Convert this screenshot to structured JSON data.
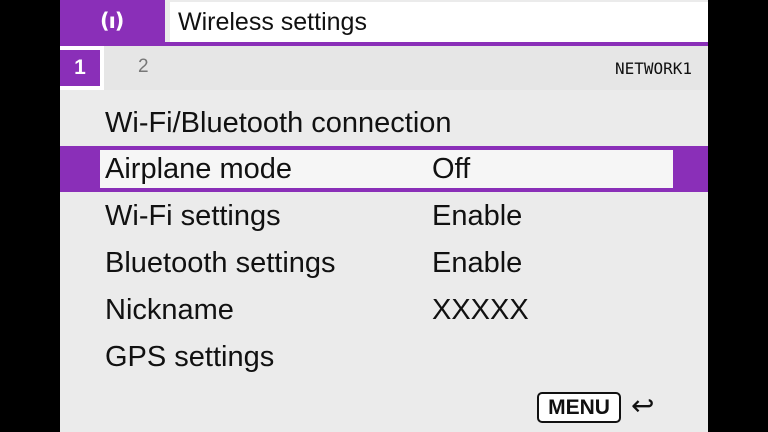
{
  "header": {
    "icon": "wifi-antenna-icon",
    "icon_glyph": "(ı)",
    "title": "Wireless settings",
    "accent_color": "#8a2fb8"
  },
  "tabs": {
    "items": [
      {
        "label": "1",
        "active": true
      },
      {
        "label": "2",
        "active": false
      }
    ],
    "page_name": "NETWORK1"
  },
  "menu": {
    "items": [
      {
        "label": "Wi-Fi/Bluetooth connection",
        "value": ""
      },
      {
        "label": "Airplane mode",
        "value": "Off",
        "selected": true
      },
      {
        "label": "Wi-Fi settings",
        "value": "Enable"
      },
      {
        "label": "Bluetooth settings",
        "value": "Enable"
      },
      {
        "label": "Nickname",
        "value": "XXXXX"
      },
      {
        "label": "GPS settings",
        "value": ""
      }
    ]
  },
  "footer": {
    "menu_button": "MENU",
    "back_icon": "back-arrow-icon",
    "back_glyph": "↩"
  }
}
